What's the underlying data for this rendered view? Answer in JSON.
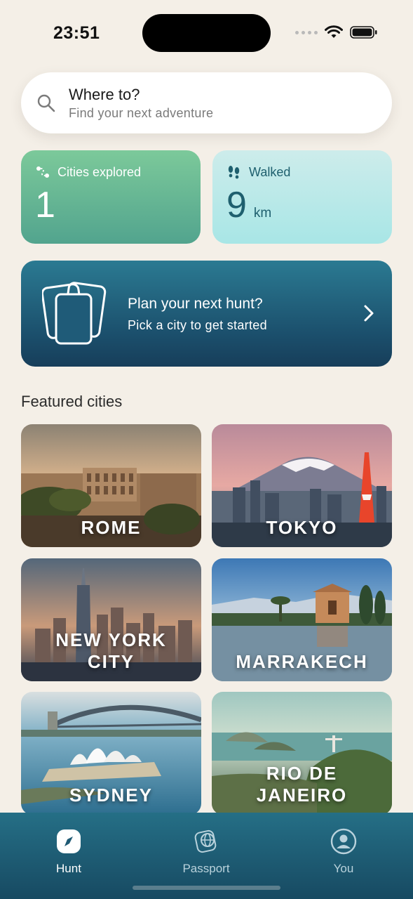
{
  "status_bar": {
    "time": "23:51"
  },
  "search": {
    "title": "Where to?",
    "subtitle": "Find your next adventure"
  },
  "stats": {
    "cities": {
      "label": "Cities explored",
      "value": "1"
    },
    "walked": {
      "label": "Walked",
      "value": "9",
      "unit": "km"
    }
  },
  "plan": {
    "title": "Plan your next hunt?",
    "subtitle": "Pick a city to get started"
  },
  "featured": {
    "title": "Featured cities",
    "cities": [
      "ROME",
      "TOKYO",
      "NEW YORK CITY",
      "MARRAKECH",
      "SYDNEY",
      "RIO DE JANEIRO"
    ]
  },
  "tabbar": {
    "items": [
      {
        "label": "Hunt",
        "icon": "compass-icon",
        "active": true
      },
      {
        "label": "Passport",
        "icon": "passport-globe-icon",
        "active": false
      },
      {
        "label": "You",
        "icon": "user-icon",
        "active": false
      }
    ]
  },
  "colors": {
    "background": "#f4efe7",
    "cities_card": "#52a48e",
    "walked_card": "#a8e6e6",
    "plan_card": "#1b4f6c",
    "tabbar": "#1a5670"
  }
}
